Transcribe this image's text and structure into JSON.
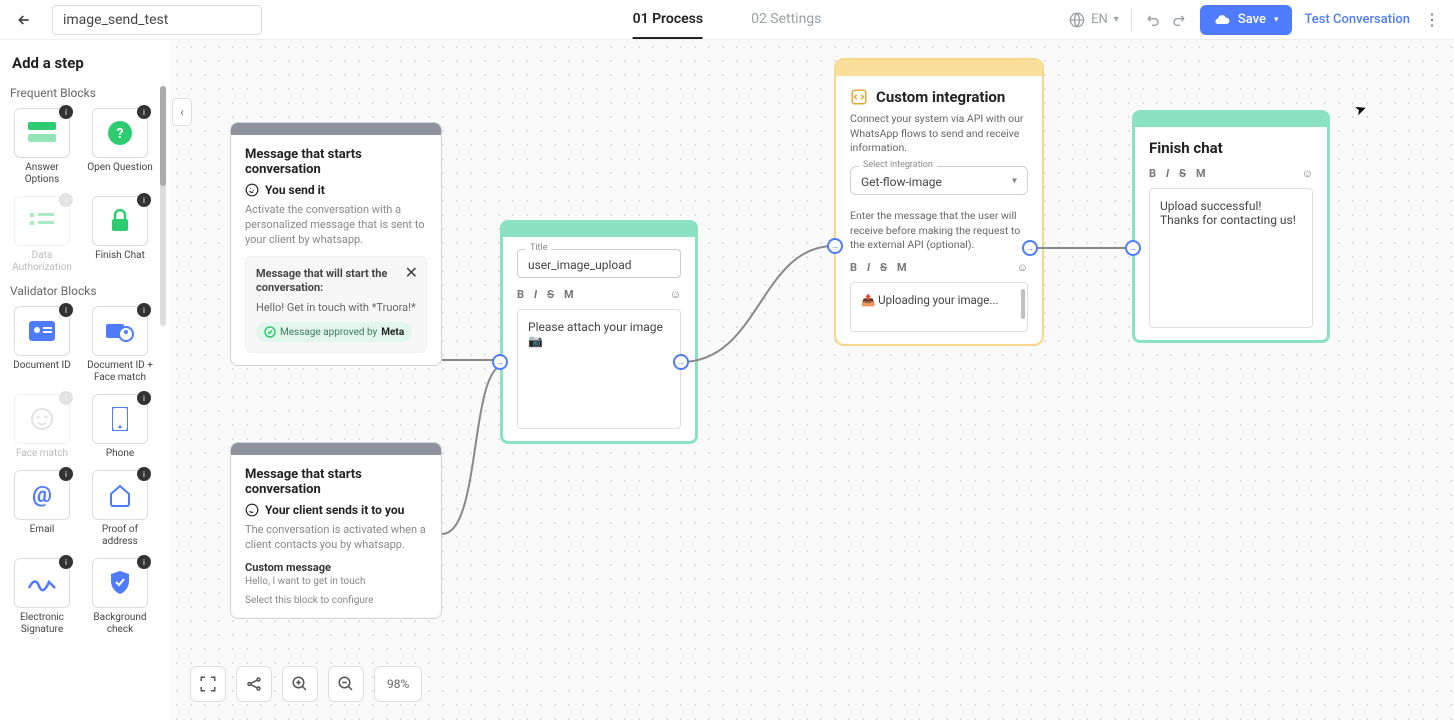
{
  "header": {
    "flow_name": "image_send_test",
    "tabs": {
      "process": "01 Process",
      "settings": "02 Settings"
    },
    "language": "EN",
    "save_label": "Save",
    "test_label": "Test Conversation"
  },
  "sidebar": {
    "title": "Add a step",
    "sections": {
      "frequent": "Frequent Blocks",
      "validator": "Validator Blocks"
    },
    "tiles": {
      "answer_options": "Answer Options",
      "open_question": "Open Question",
      "data_auth": "Data Authorization",
      "finish_chat": "Finish Chat",
      "document_id": "Document ID",
      "document_id_face": "Document ID + Face match",
      "face_match": "Face match",
      "phone": "Phone",
      "email": "Email",
      "proof_address": "Proof of address",
      "electronic_sig": "Electronic Signature",
      "background_check": "Background check"
    }
  },
  "nodes": {
    "start1": {
      "title": "Message that starts conversation",
      "sub": "You send it",
      "desc": "Activate the conversation with a personalized message that is sent to your client by whatsapp.",
      "inner_label": "Message that will start the conversation:",
      "inner_msg": "Hello! Get in touch with *Truora!*",
      "approved_prefix": "Message approved by ",
      "approved_by": "Meta"
    },
    "start2": {
      "title": "Message that starts conversation",
      "sub": "Your client sends it to you",
      "desc": "The conversation is activated when a client contacts you by whatsapp.",
      "sec_label": "Custom message",
      "sec_text": "Hello, I want to get in touch",
      "config": "Select this block to configure"
    },
    "upload": {
      "title_label": "Title",
      "title_value": "user_image_upload",
      "body": "Please attach your image 📷"
    },
    "custom": {
      "title": "Custom integration",
      "desc": "Connect your system via API with our WhatsApp flows to send and receive information.",
      "sel_label": "Select integration",
      "sel_value": "Get-flow-image",
      "hint": "Enter the message that the user will receive before making the request to the external API (optional).",
      "body": "📤 Uploading your image..."
    },
    "finish": {
      "title": "Finish chat",
      "body": "Upload successful! Thanks for contacting us!"
    }
  },
  "toolbar": {
    "zoom": "98%"
  }
}
